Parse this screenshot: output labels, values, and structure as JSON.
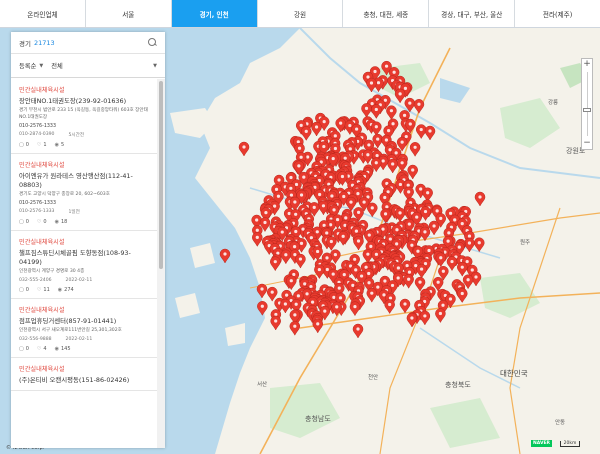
{
  "tabs": [
    {
      "label": "온라인업체",
      "active": false
    },
    {
      "label": "서울",
      "active": false
    },
    {
      "label": "경기, 인천",
      "active": true
    },
    {
      "label": "강원",
      "active": false
    },
    {
      "label": "충청, 대전, 세종",
      "active": false
    },
    {
      "label": "경상, 대구, 부산, 울산",
      "active": false
    },
    {
      "label": "전라(제주)",
      "active": false
    }
  ],
  "panel": {
    "region": "경기",
    "count": "21713",
    "sort_label": "등록순",
    "filter_label": "전체"
  },
  "listings": [
    {
      "category": "민간실내체육시설",
      "name": "장안태NO.1태권도장(239-92-01636)",
      "address": "경기 부천시 범안로 233 15 (옥길동, 옥길중앙타워) 603호 장안태 NO.1태권도장",
      "phone": "010-2576-1333",
      "extra_left": "010-2874-0390",
      "extra_right": "5시간전",
      "comments": "0",
      "likes": "1",
      "views": "5"
    },
    {
      "category": "민간실내체육시설",
      "name": "아이엔유가 원라테스 영산행산점(112-41-08803)",
      "address": "경기도 고양시 덕양구 충장로 20, 602~603호",
      "phone": "010-2576-1333",
      "extra_left": "010-2576-1333",
      "extra_right": "1일전",
      "comments": "0",
      "likes": "0",
      "views": "18"
    },
    {
      "category": "민간실내체육시설",
      "name": "챌프짐스튜딘시체골핌 도향동점(108-93-04199)",
      "address": "인천광역시 계양구 경명로 30 4층",
      "phone": "",
      "extra_left": "032-555-2406",
      "extra_right": "2022-02-11",
      "comments": "0",
      "likes": "11",
      "views": "274"
    },
    {
      "category": "민간실내체육시설",
      "name": "점프업휴딩거센터(857-91-01441)",
      "address": "인천광역시 서구 새오계로111번안길 25,301,302호",
      "phone": "",
      "extra_left": "032-556-9888",
      "extra_right": "2022-02-11",
      "comments": "0",
      "likes": "4",
      "views": "145"
    },
    {
      "category": "민간실내체육시설",
      "name": "(주)온티비 오캔시평동(151-86-02426)",
      "address": "",
      "phone": "",
      "extra_left": "",
      "extra_right": "",
      "comments": "",
      "likes": "",
      "views": ""
    }
  ],
  "map": {
    "labels": [
      {
        "text": "강원도"
      },
      {
        "text": "충청북도"
      },
      {
        "text": "대한민국"
      },
      {
        "text": "충청남도"
      },
      {
        "text": "서산"
      },
      {
        "text": "천안"
      },
      {
        "text": "원주"
      },
      {
        "text": "강릉"
      },
      {
        "text": "안동"
      }
    ],
    "copyright": "© NAVER Corp.",
    "naver_badge": "NAVER",
    "scale_text": "20km",
    "zoom_in": "+",
    "zoom_out": "−",
    "marker_color": "#e83a2e",
    "water_color": "#b9d9ec",
    "land_color": "#f4f2ea"
  }
}
